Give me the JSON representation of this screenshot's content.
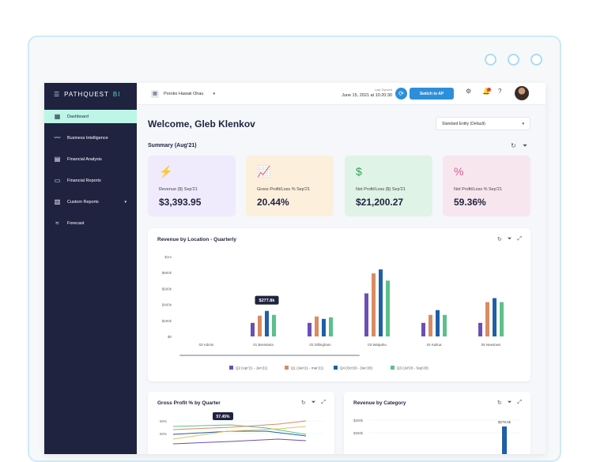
{
  "brand": {
    "name": "PATHQUEST",
    "suffix": "BI"
  },
  "sidebar": {
    "items": [
      {
        "label": "Dashboard",
        "icon": "dashboard-icon",
        "active": true
      },
      {
        "label": "Business Intelligence",
        "icon": "trend-icon"
      },
      {
        "label": "Financial Analysis",
        "icon": "analysis-icon"
      },
      {
        "label": "Financial Reports",
        "icon": "reports-icon"
      },
      {
        "label": "Custom Reports",
        "icon": "custom-reports-icon",
        "has_caret": true
      },
      {
        "label": "Forecast",
        "icon": "forecast-icon"
      }
    ]
  },
  "topbar": {
    "organization": "Poroko Hawaii Ohau",
    "last_synced_label": "Last Synced",
    "last_synced_value": "June 15, 2021 at 10:20:30",
    "switch_button": "Switch to AP"
  },
  "main": {
    "welcome": "Welcome, Gleb Klenkov",
    "entity_select": "Standard Entity (Default)",
    "summary_title": "Summary (Aug'21)"
  },
  "kpis": [
    {
      "label": "Revenue ($) Sep'21",
      "value": "$3,393.95"
    },
    {
      "label": "Gross Profit/Loss % Sep'21",
      "value": "20.44%"
    },
    {
      "label": "Net Profit/Loss ($) Sep'21",
      "value": "$21,200.27"
    },
    {
      "label": "Net Profit/Loss % Sep'21",
      "value": "59.36%"
    }
  ],
  "charts": {
    "revenue_by_location_title": "Revenue by Location - Quarterly",
    "gross_profit_title": "Gross Profit % by Quarter",
    "revenue_by_category_title": "Revenue by Category"
  },
  "colors": {
    "series": [
      "#6b4fb6",
      "#d98b62",
      "#1f5fa8",
      "#5cc08a"
    ],
    "accent": "#2d8fd9"
  },
  "chart_data": [
    {
      "type": "bar",
      "title": "Revenue by Location - Quarterly",
      "categories": [
        "03 Admin",
        "01 Beretania",
        "02 Dillingham",
        "03 Waipahu",
        "04 Kailua",
        "05 Newtown"
      ],
      "y_ticks": [
        "$0",
        "$200k",
        "$400k",
        "$600k",
        "$800k",
        "$1m"
      ],
      "ylim": [
        0,
        1000000
      ],
      "series": [
        {
          "name": "Q2 (Apr'21 - Jun'21)",
          "values": [
            0,
            170000,
            170000,
            540000,
            170000,
            170000
          ]
        },
        {
          "name": "Q1 (Jan'21 - mar'21)",
          "values": [
            0,
            260000,
            250000,
            790000,
            270000,
            430000
          ]
        },
        {
          "name": "Q4 (Oct'20 - Dec'20)",
          "values": [
            0,
            320000,
            220000,
            840000,
            330000,
            480000
          ]
        },
        {
          "name": "Q3 (Jul'20 - Sep'20)",
          "values": [
            0,
            270000,
            240000,
            700000,
            270000,
            430000
          ]
        }
      ],
      "tooltip": "$277.8k"
    },
    {
      "type": "line",
      "title": "Gross Profit % by Quarter",
      "y_ticks": [
        "50%",
        "60%"
      ],
      "tooltip": "57.45%"
    },
    {
      "type": "bar",
      "title": "Revenue by Category",
      "y_ticks": [
        "$250k",
        "$300k"
      ],
      "tooltip": "$278.5k"
    }
  ]
}
